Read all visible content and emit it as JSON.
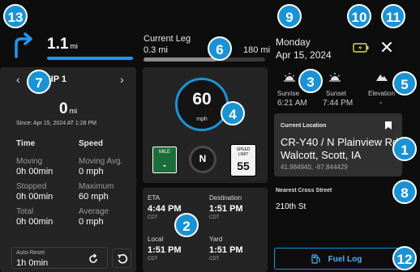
{
  "nav": {
    "distance_value": "1.1",
    "distance_unit": "mi"
  },
  "leg": {
    "label": "Current Leg",
    "value": "0.3 mi",
    "end_value": "180 mi",
    "progress": 0.6
  },
  "clock": {
    "day": "Monday",
    "date": "Apr 15, 2024"
  },
  "trip": {
    "title": "TRIP 1",
    "distance_value": "0",
    "distance_unit": "mi",
    "since": "Since: Apr 15, 2024 AT 1:28 PM",
    "time_header": "Time",
    "speed_header": "Speed",
    "moving_label": "Moving",
    "moving_value": "0h 00min",
    "moving_avg_label": "Moving Avg.",
    "moving_avg_value": "0 mph",
    "stopped_label": "Stopped",
    "stopped_value": "0h 00min",
    "maximum_label": "Maximum",
    "maximum_value": "60 mph",
    "total_label": "Total",
    "total_value": "0h 00min",
    "average_label": "Average",
    "average_value": "0 mph",
    "autoreset_label": "Auto-Reset",
    "autoreset_value": "1h 0min"
  },
  "speed": {
    "value": "60",
    "unit": "mph"
  },
  "mile_marker": {
    "label": "MILE",
    "value": "-"
  },
  "compass": {
    "heading": "N"
  },
  "speed_limit": {
    "label_line1": "SPEED",
    "label_line2": "LIMIT",
    "value": "55"
  },
  "eta": {
    "eta_label": "ETA",
    "eta_value": "4:44 PM",
    "eta_tz": "CDT",
    "destination_label": "Destination",
    "destination_value": "1:51 PM",
    "destination_tz": "CDT",
    "local_label": "Local",
    "local_value": "1:51 PM",
    "local_tz": "CDT",
    "yard_label": "Yard",
    "yard_value": "1:51 PM",
    "yard_tz": "CDT"
  },
  "sun": {
    "sunrise_label": "Sunrise",
    "sunrise_value": "6:21 AM",
    "sunset_label": "Sunset",
    "sunset_value": "7:44 PM",
    "elevation_label": "Elevation",
    "elevation_value": "-"
  },
  "location": {
    "header": "Current Location",
    "line1": "CR-Y40 / N Plainview Rd",
    "line2": "Walcott, Scott, IA",
    "coords": "41.984940, -87.844429"
  },
  "cross_street": {
    "header": "Nearest Cross Street",
    "value": "210th St"
  },
  "fuel_log": {
    "label": "Fuel Log"
  },
  "markers": {
    "m1": "1",
    "m2": "2",
    "m3": "3",
    "m4": "4",
    "m5": "5",
    "m6": "6",
    "m7": "7",
    "m8": "8",
    "m9": "9",
    "m10": "10",
    "m11": "11",
    "m12": "12",
    "m13": "13"
  },
  "colors": {
    "accent": "#1a93d4",
    "panel": "#242424",
    "background": "#0d0d0d",
    "mile_green": "#1b6e3a"
  },
  "icons": [
    "turn-right-arrow-icon",
    "battery-charging-icon",
    "close-icon",
    "chevron-left-icon",
    "chevron-right-icon",
    "reset-icon",
    "undo-icon",
    "sunrise-icon",
    "sunset-icon",
    "mountain-icon",
    "bookmark-icon",
    "fuel-pump-icon"
  ]
}
